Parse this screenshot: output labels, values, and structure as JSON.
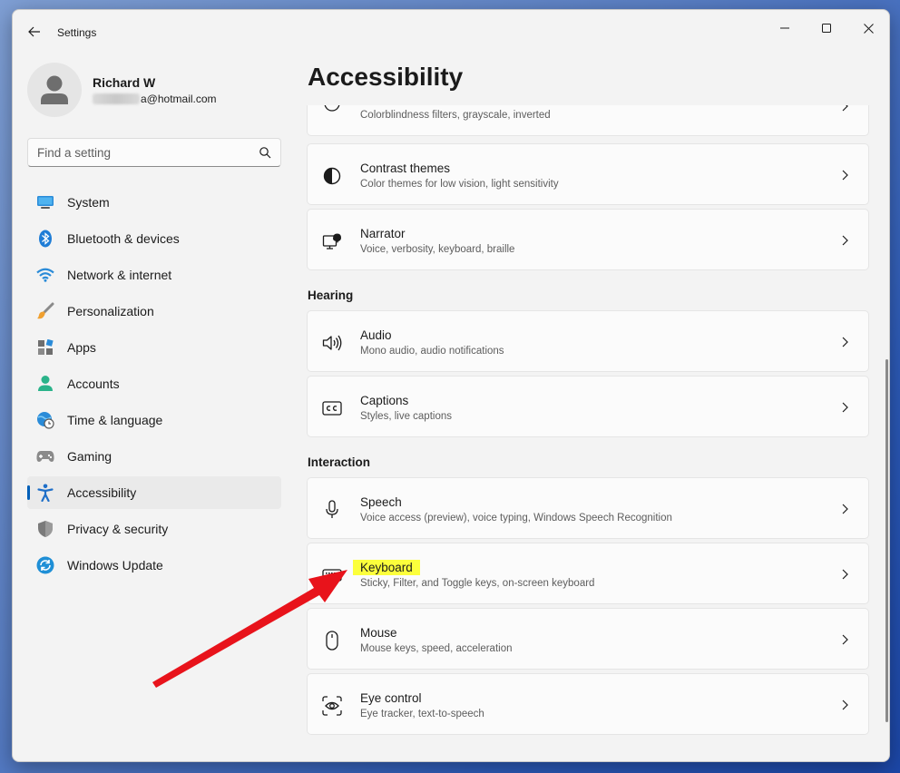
{
  "app": {
    "title": "Settings"
  },
  "profile": {
    "name": "Richard W",
    "email_suffix": "a@hotmail.com"
  },
  "search": {
    "placeholder": "Find a setting"
  },
  "nav": {
    "items": [
      {
        "label": "System",
        "icon": "monitor-icon"
      },
      {
        "label": "Bluetooth & devices",
        "icon": "bluetooth-icon"
      },
      {
        "label": "Network & internet",
        "icon": "wifi-icon"
      },
      {
        "label": "Personalization",
        "icon": "brush-icon"
      },
      {
        "label": "Apps",
        "icon": "apps-icon"
      },
      {
        "label": "Accounts",
        "icon": "person-icon"
      },
      {
        "label": "Time & language",
        "icon": "globe-clock-icon"
      },
      {
        "label": "Gaming",
        "icon": "gamepad-icon"
      },
      {
        "label": "Accessibility",
        "icon": "accessibility-icon",
        "active": true
      },
      {
        "label": "Privacy & security",
        "icon": "shield-icon"
      },
      {
        "label": "Windows Update",
        "icon": "update-icon"
      }
    ]
  },
  "main": {
    "title": "Accessibility",
    "partial_card": {
      "subtitle": "Colorblindness filters, grayscale, inverted"
    },
    "cards": [
      {
        "title": "Contrast themes",
        "subtitle": "Color themes for low vision, light sensitivity",
        "icon": "contrast-icon"
      },
      {
        "title": "Narrator",
        "subtitle": "Voice, verbosity, keyboard, braille",
        "icon": "narrator-icon"
      }
    ],
    "hearing": {
      "header": "Hearing",
      "cards": [
        {
          "title": "Audio",
          "subtitle": "Mono audio, audio notifications",
          "icon": "speaker-icon"
        },
        {
          "title": "Captions",
          "subtitle": "Styles, live captions",
          "icon": "captions-icon"
        }
      ]
    },
    "interaction": {
      "header": "Interaction",
      "cards": [
        {
          "title": "Speech",
          "subtitle": "Voice access (preview), voice typing, Windows Speech Recognition",
          "icon": "microphone-icon"
        },
        {
          "title": "Keyboard",
          "subtitle": "Sticky, Filter, and Toggle keys, on-screen keyboard",
          "icon": "keyboard-icon",
          "highlighted": true
        },
        {
          "title": "Mouse",
          "subtitle": "Mouse keys, speed, acceleration",
          "icon": "mouse-icon"
        },
        {
          "title": "Eye control",
          "subtitle": "Eye tracker, text-to-speech",
          "icon": "eye-control-icon"
        }
      ]
    }
  },
  "colors": {
    "accent": "#005fb8",
    "highlight": "#fcff3c",
    "annotation_arrow": "#e8131b"
  }
}
